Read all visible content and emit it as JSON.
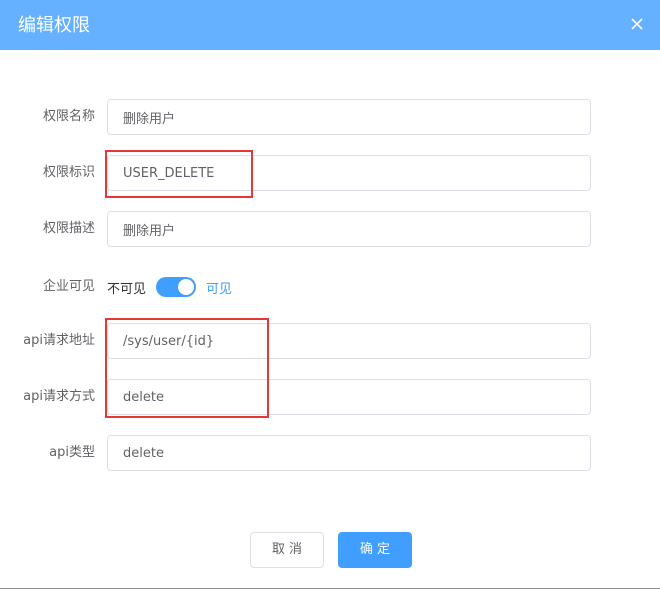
{
  "dialog": {
    "title": "编辑权限",
    "close_icon": "close-icon"
  },
  "form": {
    "name_label": "权限名称",
    "name_value": "删除用户",
    "code_label": "权限标识",
    "code_value": "USER_DELETE",
    "desc_label": "权限描述",
    "desc_value": "删除用户",
    "visible_label": "企业可见",
    "visible_off_text": "不可见",
    "visible_on_text": "可见",
    "visible_state": true,
    "api_url_label": "api请求地址",
    "api_url_value": "/sys/user/{id}",
    "api_method_label": "api请求方式",
    "api_method_value": "delete",
    "api_type_label": "api类型",
    "api_type_value": "delete"
  },
  "footer": {
    "cancel_label": "取消",
    "confirm_label": "确定"
  },
  "colors": {
    "header_bg": "#66b1ff",
    "primary": "#409eff",
    "highlight": "#e53935"
  }
}
